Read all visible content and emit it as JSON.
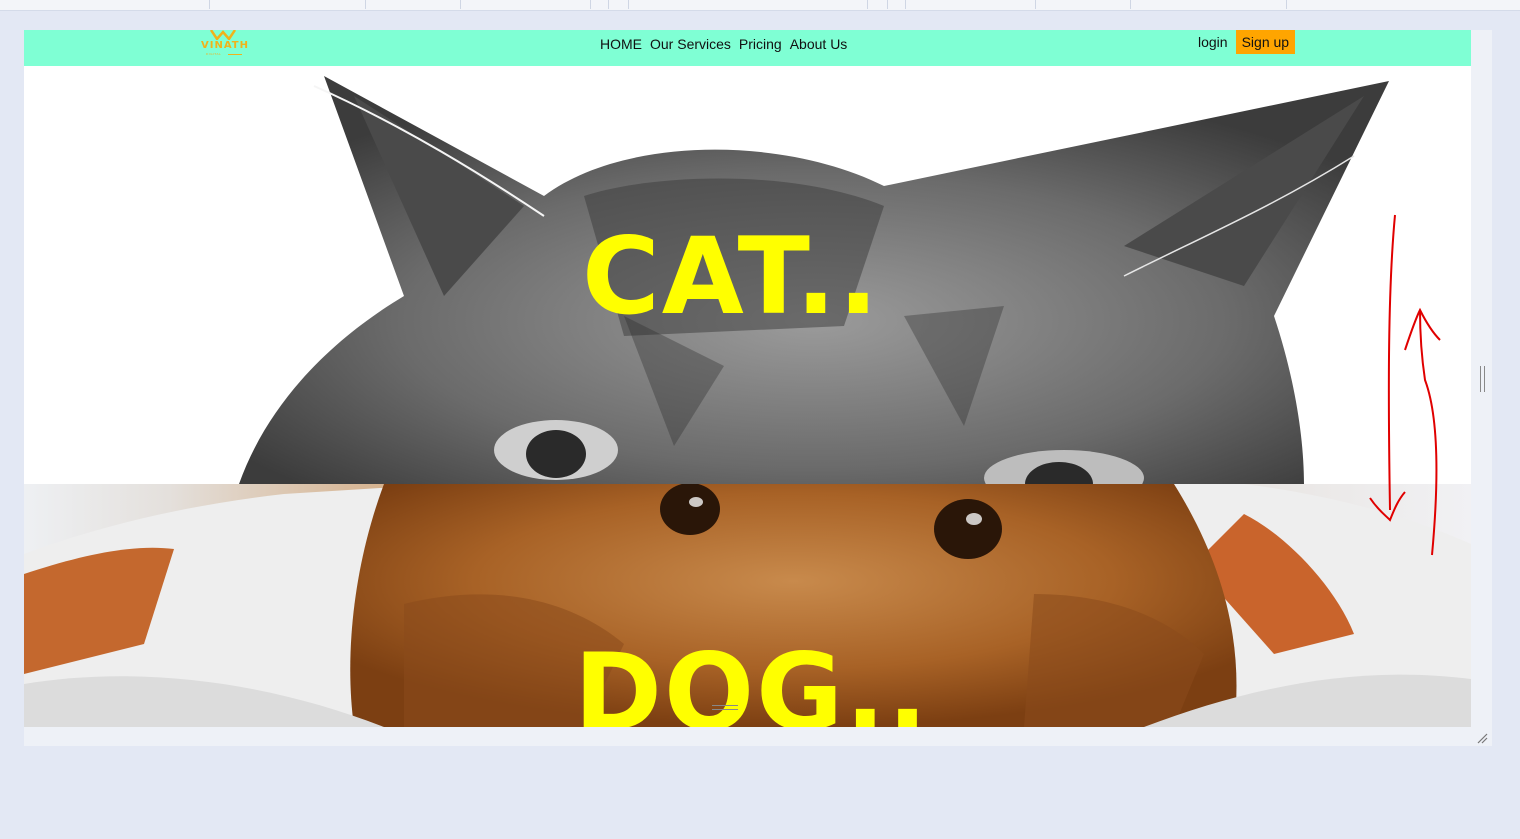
{
  "navbar": {
    "logo_text": "VINATH",
    "logo_sub": "DIGITAL",
    "links": [
      "HOME",
      "Our Services",
      "Pricing",
      "About Us"
    ],
    "login_label": "login",
    "signup_label": "Sign up"
  },
  "hero": {
    "cat_title": "CAT..",
    "dog_title": "DOG.."
  },
  "colors": {
    "navbar_bg": "#7fffd4",
    "signup_bg": "#ffa500",
    "hero_text": "#ffff00",
    "logo": "#f1b21a",
    "annotation": "#e00000"
  },
  "icons": [
    "vinath-logo-icon",
    "cat-photo",
    "dog-photo",
    "resize-handle-icon",
    "arrow-annotation"
  ]
}
